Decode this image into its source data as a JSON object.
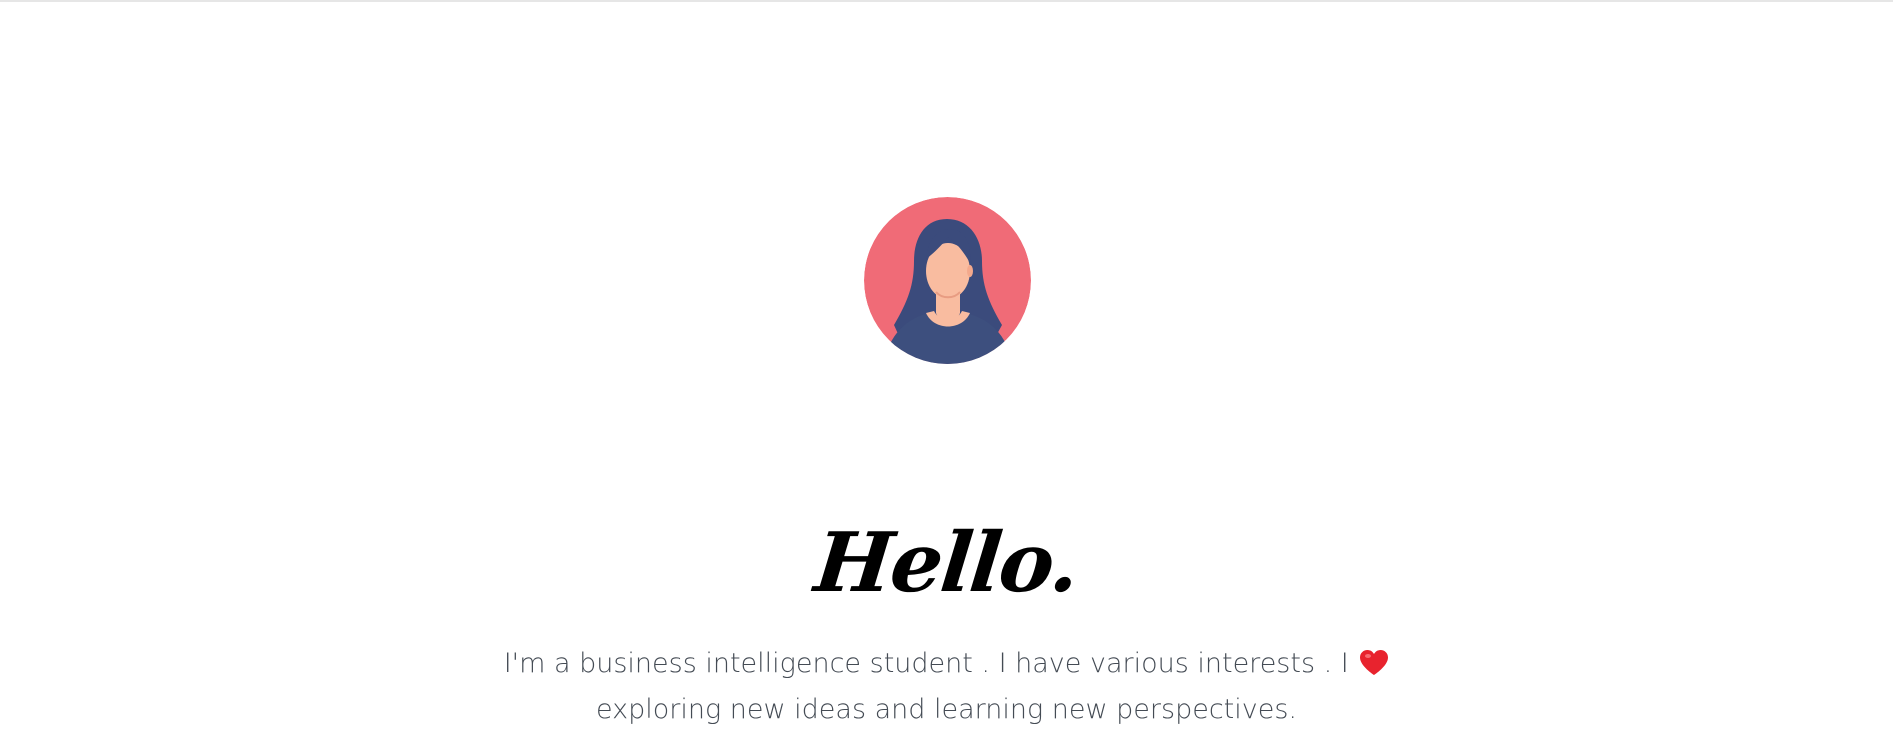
{
  "hero": {
    "title": "Hello.",
    "bio_part1": "I'm a business intelligence student . I have various interests . I ",
    "bio_part2": " exploring new ideas and learning new perspectives.",
    "heart_icon": "heart-icon"
  },
  "colors": {
    "avatar_bg": "#f06b77",
    "hair": "#3b4b7c",
    "skin": "#f9bca0",
    "shirt": "#3d4f7e",
    "heart": "#e8232e",
    "text": "#444b54"
  }
}
